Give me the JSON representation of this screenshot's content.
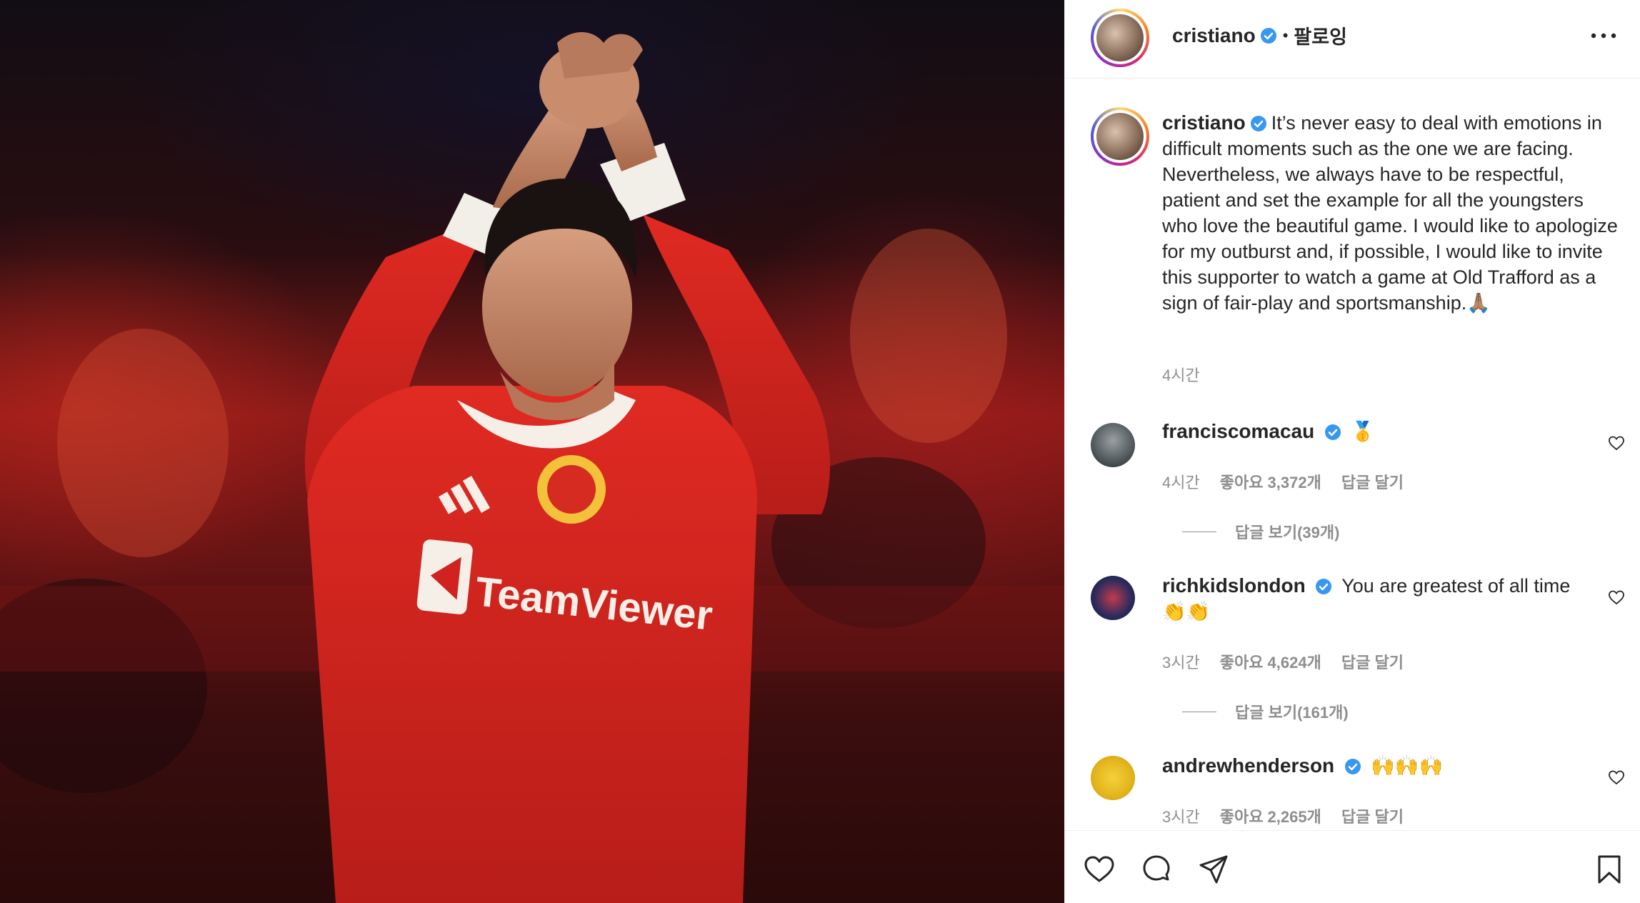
{
  "post": {
    "author": "cristiano",
    "follow_label": "팔로잉",
    "caption": "It’s never easy to deal with emotions in difficult moments such as the one we are facing. Nevertheless, we always have to be respectful, patient and set the example for all the youngsters who love the beautiful game. I would like to apologize for my outburst and, if possible, I would like to invite this supporter to watch a game at Old Trafford as a sign of fair-play and sportsmanship.🙏🏽",
    "time": "4시간"
  },
  "comments": [
    {
      "username": "franciscomacau",
      "text": "🥇",
      "time": "4시간",
      "likes": "좋아요 3,372개",
      "reply_label": "답글 달기",
      "view_replies": "답글 보기(39개)"
    },
    {
      "username": "richkidslondon",
      "text": "You are greatest of all time 👏👏",
      "time": "3시간",
      "likes": "좋아요 4,624개",
      "reply_label": "답글 달기",
      "view_replies": "답글 보기(161개)"
    },
    {
      "username": "andrewhenderson",
      "text": "🙌🙌🙌",
      "time": "3시간",
      "likes": "좋아요 2,265개",
      "reply_label": "답글 달기"
    }
  ],
  "photo_text": {
    "sponsor": "TeamViewer"
  },
  "icons": {
    "more": "more-options-icon",
    "verified": "verified-badge-icon",
    "like": "heart-icon",
    "comment": "comment-icon",
    "share": "share-icon",
    "save": "bookmark-icon"
  },
  "colors": {
    "verified": "#3897f0",
    "muted": "#8e8e8e",
    "text": "#262626",
    "kit_red": "#d0231f"
  }
}
